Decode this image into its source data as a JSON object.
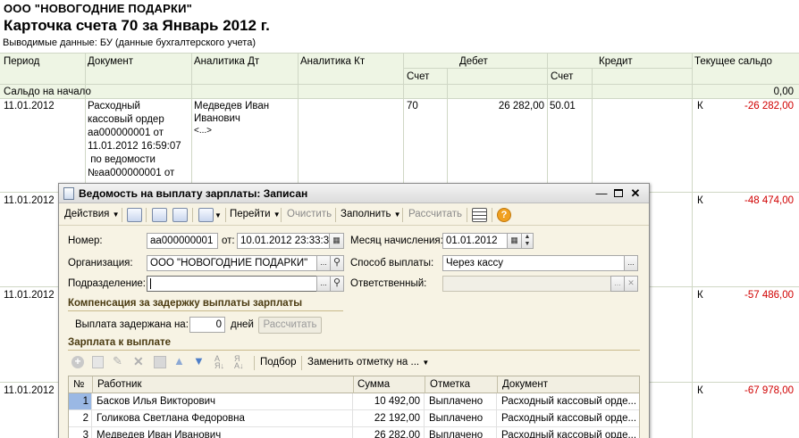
{
  "report": {
    "company": "ООО \"НОВОГОДНИЕ ПОДАРКИ\"",
    "title": "Карточка счета 70 за Январь 2012 г.",
    "subtitle": "Выводимые данные:  БУ (данные бухгалтерского учета)",
    "headers": {
      "period": "Период",
      "document": "Документ",
      "analytics_dt": "Аналитика Дт",
      "analytics_kt": "Аналитика Кт",
      "debit": "Дебет",
      "credit": "Кредит",
      "balance": "Текущее сальдо",
      "account_dt": "Счет",
      "account_kt": "Счет"
    },
    "opening": {
      "label": "Сальдо на начало",
      "value": "0,00"
    },
    "rows": [
      {
        "date": "11.01.2012",
        "doc_lines": [
          "Расходный",
          "кассовый ордер",
          "аа000000001 от",
          "11.01.2012 16:59:07",
          " по ведомости",
          "№аа000000001 от"
        ],
        "analytics_lines": [
          "Медведев Иван",
          "Иванович",
          "<...>"
        ],
        "debit_account": "70",
        "debit_amount": "26 282,00",
        "credit_account": "50.01",
        "balance_type": "К",
        "balance": "-26 282,00"
      },
      {
        "date": "11.01.2012",
        "balance_type": "К",
        "balance": "-48 474,00"
      },
      {
        "date": "11.01.2012",
        "balance_type": "К",
        "balance": "-57 486,00"
      },
      {
        "date": "11.01.2012",
        "balance_type": "К",
        "balance": "-67 978,00"
      }
    ]
  },
  "dialog": {
    "title": "Ведомость на выплату зарплаты: Записан",
    "toolbar": {
      "actions": "Действия",
      "goto": "Перейти",
      "clear": "Очистить",
      "fill": "Заполнить",
      "calculate": "Рассчитать"
    },
    "form": {
      "number_label": "Номер:",
      "number_value": "аа000000001",
      "from_label": "от:",
      "date_value": "10.01.2012 23:33:34",
      "month_label": "Месяц начисления:",
      "month_value": "01.01.2012",
      "org_label": "Организация:",
      "org_value": "ООО \"НОВОГОДНИЕ ПОДАРКИ\"",
      "payment_label": "Способ выплаты:",
      "payment_value": "Через кассу",
      "dept_label": "Подразделение:",
      "dept_value": "",
      "responsible_label": "Ответственный:",
      "responsible_value": ""
    },
    "compensation": {
      "header": "Компенсация за задержку выплаты зарплаты",
      "delay_label": "Выплата задержана на:",
      "delay_value": "0",
      "days_label": "дней",
      "calc_button": "Рассчитать"
    },
    "payroll": {
      "header": "Зарплата к выплате",
      "toolbar_selection": "Подбор",
      "toolbar_replace": "Заменить отметку на ...",
      "columns": {
        "num": "№",
        "employee": "Работник",
        "amount": "Сумма",
        "mark": "Отметка",
        "document": "Документ"
      },
      "rows": [
        {
          "num": "1",
          "employee": "Басков Илья Викторович",
          "amount": "10 492,00",
          "mark": "Выплачено",
          "document": "Расходный кассовый орде..."
        },
        {
          "num": "2",
          "employee": "Голикова Светлана Федоровна",
          "amount": "22 192,00",
          "mark": "Выплачено",
          "document": "Расходный кассовый орде..."
        },
        {
          "num": "3",
          "employee": "Медведев Иван Иванович",
          "amount": "26 282,00",
          "mark": "Выплачено",
          "document": "Расходный кассовый орде..."
        }
      ]
    }
  }
}
